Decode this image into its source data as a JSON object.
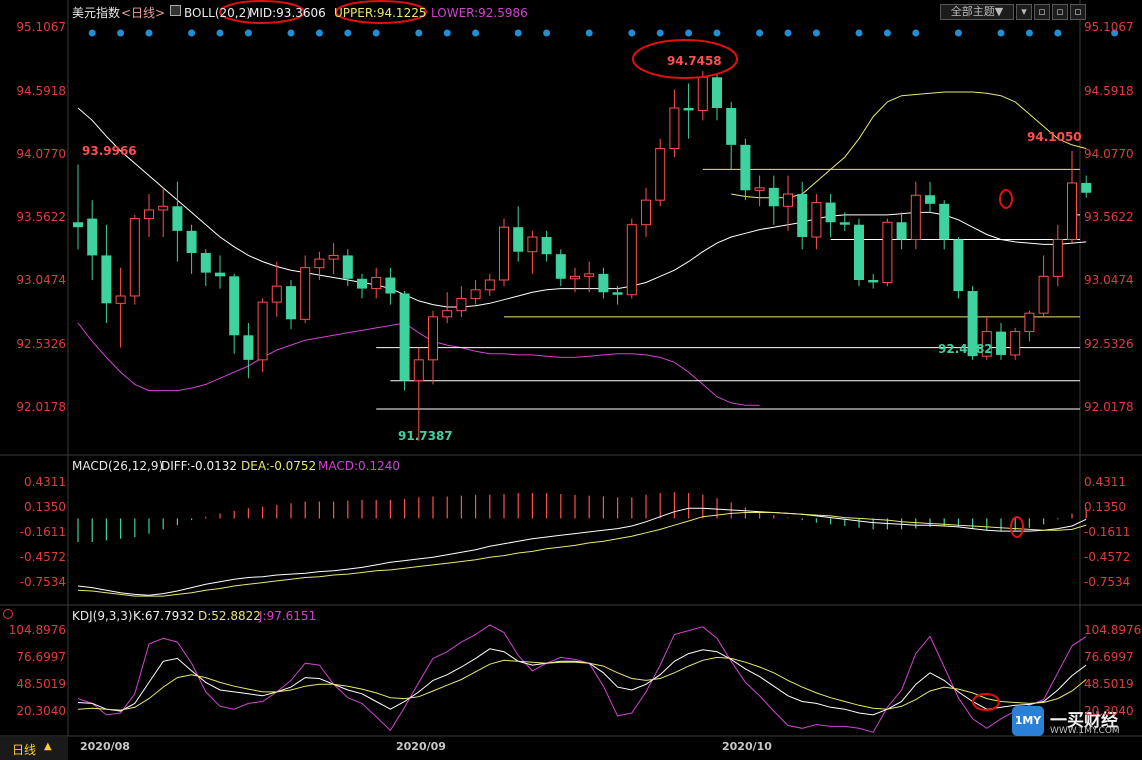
{
  "header": {
    "symbol": "美元指数",
    "period_tag": "<日线>",
    "boll": "BOLL(20,2)",
    "mid": "MID:93.3606",
    "upper": "UPPER:94.1225",
    "lower": "LOWER:92.5986",
    "theme_button": "全部主题▼"
  },
  "macd_header": {
    "title": "MACD(26,12,9)",
    "diff": "DIFF:-0.0132",
    "dea": "DEA:-0.0752",
    "macd": "MACD:0.1240"
  },
  "kdj_header": {
    "title": "KDJ(9,3,3)",
    "k": "K:67.7932",
    "d": "D:52.8822",
    "j": "J:97.6151"
  },
  "footer": {
    "period_label": "日线",
    "months": [
      "2020/08",
      "2020/09",
      "2020/10"
    ]
  },
  "logo": {
    "name": "一买财经",
    "url": "WWW.1MY.COM"
  },
  "annotations": {
    "high_left": "93.9966",
    "peak": "94.7458",
    "right_high": "94.1050",
    "low": "91.7387",
    "right_low": "92.4682"
  },
  "colors": {
    "up": "#ff4f4f",
    "down": "#3ed29e",
    "axis_text": "#e03c3c",
    "boll_mid": "#ffffff",
    "boll_upper": "#e8e86e",
    "boll_lower": "#d044d0",
    "circle": "#e01010",
    "dots": "#1f8fd8"
  },
  "chart_data": [
    {
      "type": "candlestick",
      "name_ref": "美元指数 日线 BOLL",
      "yticks": [
        95.1067,
        94.5918,
        94.077,
        93.5622,
        93.0474,
        92.5326,
        92.0178
      ],
      "ylim": [
        91.65,
        95.15
      ],
      "candles": [
        [
          93.52,
          93.48,
          93.99,
          93.3
        ],
        [
          93.55,
          93.25,
          93.7,
          93.05
        ],
        [
          93.25,
          92.86,
          93.5,
          92.7
        ],
        [
          92.86,
          92.92,
          93.15,
          92.5
        ],
        [
          92.92,
          93.55,
          93.58,
          92.85
        ],
        [
          93.55,
          93.62,
          93.75,
          93.4
        ],
        [
          93.62,
          93.65,
          93.8,
          93.4
        ],
        [
          93.65,
          93.45,
          93.85,
          93.2
        ],
        [
          93.45,
          93.27,
          93.5,
          93.1
        ],
        [
          93.27,
          93.11,
          93.3,
          93.0
        ],
        [
          93.11,
          93.08,
          93.25,
          92.98
        ],
        [
          93.08,
          92.6,
          93.1,
          92.45
        ],
        [
          92.6,
          92.4,
          92.7,
          92.25
        ],
        [
          92.4,
          92.87,
          92.9,
          92.3
        ],
        [
          92.87,
          93.0,
          93.2,
          92.75
        ],
        [
          93.0,
          92.73,
          93.05,
          92.65
        ],
        [
          92.73,
          93.15,
          93.25,
          92.7
        ],
        [
          93.15,
          93.22,
          93.28,
          93.05
        ],
        [
          93.22,
          93.25,
          93.35,
          93.1
        ],
        [
          93.25,
          93.06,
          93.3,
          93.0
        ],
        [
          93.06,
          92.98,
          93.1,
          92.9
        ],
        [
          92.98,
          93.07,
          93.15,
          92.9
        ],
        [
          93.07,
          92.94,
          93.15,
          92.85
        ],
        [
          92.94,
          92.23,
          92.96,
          92.15
        ],
        [
          92.23,
          92.4,
          92.5,
          91.74
        ],
        [
          92.4,
          92.75,
          92.8,
          92.2
        ],
        [
          92.75,
          92.8,
          92.95,
          92.7
        ],
        [
          92.8,
          92.9,
          93.0,
          92.75
        ],
        [
          92.9,
          92.97,
          93.05,
          92.85
        ],
        [
          92.97,
          93.05,
          93.1,
          92.92
        ],
        [
          93.05,
          93.48,
          93.55,
          93.0
        ],
        [
          93.48,
          93.28,
          93.65,
          93.2
        ],
        [
          93.28,
          93.4,
          93.45,
          93.1
        ],
        [
          93.4,
          93.26,
          93.45,
          93.2
        ],
        [
          93.26,
          93.06,
          93.3,
          93.0
        ],
        [
          93.06,
          93.08,
          93.15,
          92.95
        ],
        [
          93.08,
          93.1,
          93.2,
          92.95
        ],
        [
          93.1,
          92.95,
          93.15,
          92.9
        ],
        [
          92.95,
          92.93,
          93.0,
          92.85
        ],
        [
          92.93,
          93.5,
          93.55,
          92.9
        ],
        [
          93.5,
          93.7,
          93.8,
          93.4
        ],
        [
          93.7,
          94.12,
          94.2,
          93.65
        ],
        [
          94.12,
          94.45,
          94.6,
          94.05
        ],
        [
          94.45,
          94.43,
          94.65,
          94.2
        ],
        [
          94.43,
          94.7,
          94.75,
          94.35
        ],
        [
          94.7,
          94.45,
          94.72,
          94.35
        ],
        [
          94.45,
          94.15,
          94.5,
          93.95
        ],
        [
          94.15,
          93.78,
          94.2,
          93.7
        ],
        [
          93.78,
          93.8,
          93.9,
          93.65
        ],
        [
          93.8,
          93.65,
          93.9,
          93.5
        ],
        [
          93.65,
          93.75,
          93.9,
          93.45
        ],
        [
          93.75,
          93.4,
          93.85,
          93.3
        ],
        [
          93.4,
          93.68,
          93.75,
          93.3
        ],
        [
          93.68,
          93.52,
          93.75,
          93.4
        ],
        [
          93.52,
          93.5,
          93.6,
          93.45
        ],
        [
          93.5,
          93.05,
          93.55,
          93.0
        ],
        [
          93.05,
          93.03,
          93.1,
          92.98
        ],
        [
          93.03,
          93.52,
          93.55,
          93.0
        ],
        [
          93.52,
          93.38,
          93.6,
          93.3
        ],
        [
          93.38,
          93.74,
          93.85,
          93.3
        ],
        [
          93.74,
          93.67,
          93.85,
          93.6
        ],
        [
          93.67,
          93.38,
          93.7,
          93.3
        ],
        [
          93.38,
          92.96,
          93.4,
          92.9
        ],
        [
          92.96,
          92.43,
          93.0,
          92.4
        ],
        [
          92.43,
          92.63,
          92.75,
          92.4
        ],
        [
          92.63,
          92.44,
          92.7,
          92.4
        ],
        [
          92.44,
          92.63,
          92.66,
          92.4
        ],
        [
          92.63,
          92.78,
          92.8,
          92.55
        ],
        [
          92.78,
          93.08,
          93.25,
          92.75
        ],
        [
          93.08,
          93.38,
          93.5,
          93.0
        ],
        [
          93.38,
          93.84,
          94.1,
          93.35
        ],
        [
          93.84,
          93.76,
          93.9,
          93.72
        ]
      ],
      "boll_mid": [
        94.45,
        94.35,
        94.22,
        94.1,
        94.0,
        93.9,
        93.8,
        93.7,
        93.6,
        93.5,
        93.4,
        93.32,
        93.25,
        93.2,
        93.16,
        93.13,
        93.11,
        93.09,
        93.07,
        93.05,
        93.03,
        93.01,
        92.98,
        92.93,
        92.88,
        92.85,
        92.83,
        92.83,
        92.84,
        92.86,
        92.89,
        92.92,
        92.95,
        92.97,
        92.98,
        92.98,
        92.98,
        92.98,
        92.98,
        93.0,
        93.03,
        93.08,
        93.13,
        93.2,
        93.28,
        93.35,
        93.4,
        93.43,
        93.46,
        93.48,
        93.5,
        93.52,
        93.55,
        93.57,
        93.58,
        93.58,
        93.58,
        93.58,
        93.59,
        93.6,
        93.6,
        93.58,
        93.54,
        93.48,
        93.42,
        93.38,
        93.36,
        93.35,
        93.34,
        93.34,
        93.35,
        93.36
      ],
      "boll_upper": [
        null,
        null,
        null,
        null,
        null,
        null,
        null,
        null,
        null,
        null,
        null,
        null,
        null,
        null,
        null,
        null,
        null,
        null,
        null,
        null,
        93.75,
        93.73,
        93.72,
        93.72,
        93.72,
        93.75,
        93.85,
        93.95,
        94.05,
        94.2,
        94.38,
        94.5,
        94.55,
        94.56,
        94.57,
        94.58,
        94.58,
        94.58,
        94.57,
        94.55,
        94.5,
        94.4,
        94.3,
        94.2,
        94.15,
        94.12
      ],
      "boll_lower": [
        92.7,
        92.55,
        92.42,
        92.3,
        92.2,
        92.15,
        92.15,
        92.15,
        92.17,
        92.2,
        92.25,
        92.3,
        92.35,
        92.42,
        92.48,
        92.52,
        92.56,
        92.58,
        92.6,
        92.62,
        92.64,
        92.66,
        92.68,
        92.7,
        92.62,
        92.55,
        92.52,
        92.5,
        92.47,
        92.45,
        92.45,
        92.44,
        92.44,
        92.43,
        92.42,
        92.42,
        92.43,
        92.44,
        92.45,
        92.45,
        92.44,
        92.42,
        92.38,
        92.3,
        92.2,
        92.1,
        92.05,
        92.03,
        92.03
      ],
      "hlines": [
        93.95,
        93.58,
        93.38,
        92.75,
        92.5,
        92.23,
        92.0
      ],
      "signal_dots": [
        1,
        3,
        5,
        8,
        10,
        12,
        15,
        17,
        19,
        21,
        24,
        26,
        28,
        31,
        33,
        36,
        39,
        41,
        43,
        45,
        48,
        50,
        52,
        55,
        57,
        59,
        62,
        65,
        67,
        69,
        73
      ]
    },
    {
      "type": "bar+line",
      "name_ref": "MACD(26,12,9)",
      "yticks": [
        0.4311,
        0.135,
        -0.1611,
        -0.4572,
        -0.7534
      ],
      "ylim": [
        -0.99,
        0.55
      ],
      "macd": [
        -0.28,
        -0.28,
        -0.26,
        -0.24,
        -0.22,
        -0.18,
        -0.13,
        -0.08,
        -0.02,
        0.02,
        0.06,
        0.09,
        0.12,
        0.14,
        0.16,
        0.18,
        0.2,
        0.2,
        0.2,
        0.21,
        0.22,
        0.22,
        0.22,
        0.23,
        0.25,
        0.26,
        0.26,
        0.27,
        0.28,
        0.28,
        0.29,
        0.3,
        0.3,
        0.3,
        0.29,
        0.28,
        0.27,
        0.26,
        0.25,
        0.25,
        0.28,
        0.3,
        0.31,
        0.3,
        0.28,
        0.24,
        0.19,
        0.13,
        0.08,
        0.04,
        0.01,
        -0.02,
        -0.05,
        -0.07,
        -0.09,
        -0.11,
        -0.13,
        -0.13,
        -0.13,
        -0.12,
        -0.1,
        -0.09,
        -0.1,
        -0.12,
        -0.14,
        -0.15,
        -0.14,
        -0.11,
        -0.07,
        -0.01,
        0.06,
        0.12
      ],
      "diff": [
        -0.8,
        -0.82,
        -0.85,
        -0.88,
        -0.9,
        -0.91,
        -0.89,
        -0.86,
        -0.82,
        -0.78,
        -0.75,
        -0.72,
        -0.7,
        -0.69,
        -0.67,
        -0.66,
        -0.65,
        -0.63,
        -0.62,
        -0.6,
        -0.58,
        -0.55,
        -0.52,
        -0.5,
        -0.48,
        -0.46,
        -0.43,
        -0.4,
        -0.37,
        -0.33,
        -0.3,
        -0.27,
        -0.24,
        -0.22,
        -0.2,
        -0.18,
        -0.16,
        -0.14,
        -0.12,
        -0.09,
        -0.04,
        0.02,
        0.08,
        0.12,
        0.12,
        0.11,
        0.1,
        0.09,
        0.08,
        0.07,
        0.06,
        0.05,
        0.03,
        0.01,
        -0.01,
        -0.03,
        -0.05,
        -0.06,
        -0.07,
        -0.08,
        -0.08,
        -0.09,
        -0.1,
        -0.12,
        -0.14,
        -0.15,
        -0.15,
        -0.15,
        -0.14,
        -0.12,
        -0.09,
        -0.01
      ],
      "dea": [
        -0.85,
        -0.86,
        -0.88,
        -0.9,
        -0.92,
        -0.92,
        -0.92,
        -0.9,
        -0.88,
        -0.85,
        -0.83,
        -0.8,
        -0.78,
        -0.76,
        -0.74,
        -0.72,
        -0.7,
        -0.69,
        -0.67,
        -0.66,
        -0.64,
        -0.62,
        -0.61,
        -0.59,
        -0.57,
        -0.55,
        -0.53,
        -0.51,
        -0.49,
        -0.46,
        -0.44,
        -0.41,
        -0.39,
        -0.36,
        -0.34,
        -0.32,
        -0.29,
        -0.27,
        -0.24,
        -0.21,
        -0.17,
        -0.13,
        -0.08,
        -0.03,
        0.02,
        0.04,
        0.06,
        0.07,
        0.07,
        0.07,
        0.06,
        0.05,
        0.04,
        0.03,
        0.01,
        0.0,
        -0.01,
        -0.02,
        -0.04,
        -0.05,
        -0.06,
        -0.07,
        -0.08,
        -0.09,
        -0.1,
        -0.11,
        -0.12,
        -0.13,
        -0.14,
        -0.14,
        -0.13,
        -0.08
      ]
    },
    {
      "type": "line",
      "name_ref": "KDJ(9,3,3)",
      "yticks": [
        104.8976,
        76.6997,
        48.5019,
        20.304
      ],
      "ylim": [
        -6,
        113
      ],
      "k": [
        29,
        28,
        22,
        20,
        28,
        50,
        72,
        75,
        62,
        50,
        42,
        40,
        38,
        36,
        40,
        45,
        55,
        54,
        48,
        42,
        38,
        30,
        22,
        30,
        40,
        52,
        58,
        66,
        75,
        85,
        82,
        72,
        68,
        70,
        72,
        72,
        70,
        60,
        45,
        42,
        48,
        58,
        72,
        80,
        84,
        82,
        74,
        64,
        56,
        46,
        36,
        30,
        28,
        24,
        22,
        18,
        16,
        22,
        30,
        48,
        60,
        52,
        40,
        30,
        22,
        24,
        26,
        27,
        30,
        42,
        57,
        68
      ],
      "d": [
        22,
        23,
        22,
        21,
        24,
        33,
        45,
        55,
        58,
        55,
        50,
        46,
        43,
        40,
        40,
        42,
        46,
        48,
        48,
        46,
        43,
        39,
        34,
        33,
        35,
        41,
        47,
        53,
        61,
        69,
        73,
        72,
        71,
        70,
        71,
        71,
        70,
        67,
        60,
        54,
        52,
        54,
        60,
        67,
        73,
        76,
        75,
        71,
        66,
        60,
        52,
        45,
        39,
        34,
        30,
        26,
        23,
        22,
        25,
        32,
        41,
        45,
        43,
        39,
        33,
        30,
        29,
        28,
        29,
        33,
        41,
        53
      ],
      "j": [
        33,
        28,
        16,
        18,
        38,
        90,
        96,
        92,
        70,
        40,
        25,
        22,
        28,
        30,
        40,
        52,
        70,
        68,
        48,
        34,
        28,
        14,
        0,
        24,
        50,
        75,
        82,
        92,
        100,
        110,
        102,
        78,
        62,
        70,
        76,
        74,
        70,
        46,
        15,
        18,
        40,
        68,
        100,
        104,
        108,
        96,
        72,
        50,
        36,
        20,
        5,
        2,
        6,
        4,
        4,
        2,
        -2,
        24,
        42,
        80,
        98,
        66,
        34,
        12,
        2,
        12,
        20,
        26,
        32,
        60,
        88,
        98
      ]
    }
  ]
}
